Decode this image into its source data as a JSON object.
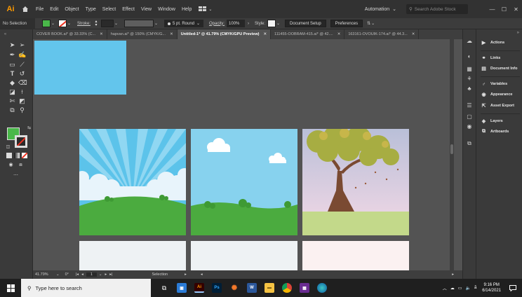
{
  "app": {
    "logo": "Ai"
  },
  "menu": [
    "File",
    "Edit",
    "Object",
    "Type",
    "Select",
    "Effect",
    "View",
    "Window",
    "Help"
  ],
  "workspace": "Automation",
  "search": {
    "placeholder": "Search Adobe Stock"
  },
  "window_controls": [
    "—",
    "☐",
    "✕"
  ],
  "control": {
    "selection": "No Selection",
    "fill_color": "#4ab84a",
    "stroke_label": "Stroke:",
    "brush": "5 pt. Round",
    "opacity_label": "Opacity:",
    "opacity_value": "100%",
    "style_label": "Style:",
    "document_setup": "Document Setup",
    "preferences": "Preferences"
  },
  "tabs": [
    {
      "label": "COVER BOOK.ai* @ 33.33% (C...",
      "active": false
    },
    {
      "label": "hapvan.ai* @ 150% (CMYK/G...",
      "active": false
    },
    {
      "label": "Untitled-1* @ 41.79% (CMYK/GPU Preview)",
      "active": true
    },
    {
      "label": "111455-OOBRAM-415.ai* @ 42....",
      "active": false
    },
    {
      "label": "163161-OVOUIK-174.ai* @ 44.3...",
      "active": false
    }
  ],
  "panels": {
    "items": [
      {
        "label": "Actions",
        "icon": "play-icon"
      },
      {
        "label": "Links",
        "icon": "link-icon"
      },
      {
        "label": "Document Info",
        "icon": "document-info-icon"
      },
      {
        "label": "Variables",
        "icon": "variables-icon"
      },
      {
        "label": "Appearance",
        "icon": "appearance-icon"
      },
      {
        "label": "Asset Export",
        "icon": "asset-export-icon"
      },
      {
        "label": "Layers",
        "icon": "layers-icon"
      },
      {
        "label": "Artboards",
        "icon": "artboards-icon"
      }
    ]
  },
  "status": {
    "zoom": "41.79%",
    "rotation": "0°",
    "artboard": "1",
    "tool": "Selection"
  },
  "taskbar": {
    "search_placeholder": "Type here to search",
    "time": "9:16 PM",
    "date": "6/14/2021"
  },
  "colors": {
    "sky": "#5cc3ea",
    "grass": "#4bab3f",
    "blue_rect": "#63c5ec",
    "tree_canopy": "#a7ad42",
    "ai_orange": "#ff9a00"
  }
}
